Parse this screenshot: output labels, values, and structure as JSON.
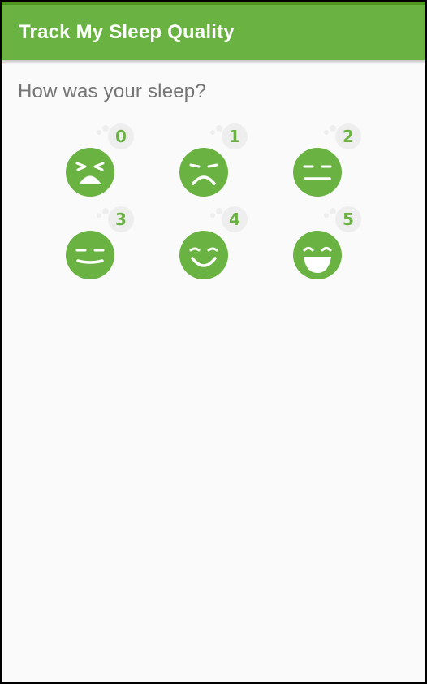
{
  "app_bar": {
    "title": "Track My Sleep Quality"
  },
  "screen": {
    "prompt": "How was your sleep?"
  },
  "qualities": [
    {
      "value": "0",
      "icon": "very-bad-face-icon"
    },
    {
      "value": "1",
      "icon": "sad-face-icon"
    },
    {
      "value": "2",
      "icon": "neutral-face-icon"
    },
    {
      "value": "3",
      "icon": "content-face-icon"
    },
    {
      "value": "4",
      "icon": "happy-face-icon"
    },
    {
      "value": "5",
      "icon": "very-happy-face-icon"
    }
  ],
  "colors": {
    "accent": "#6ab343",
    "status_bar": "#4e9a1f",
    "background": "#fafafa",
    "badge_bg": "#eeeeee",
    "prompt_text": "#757575"
  }
}
